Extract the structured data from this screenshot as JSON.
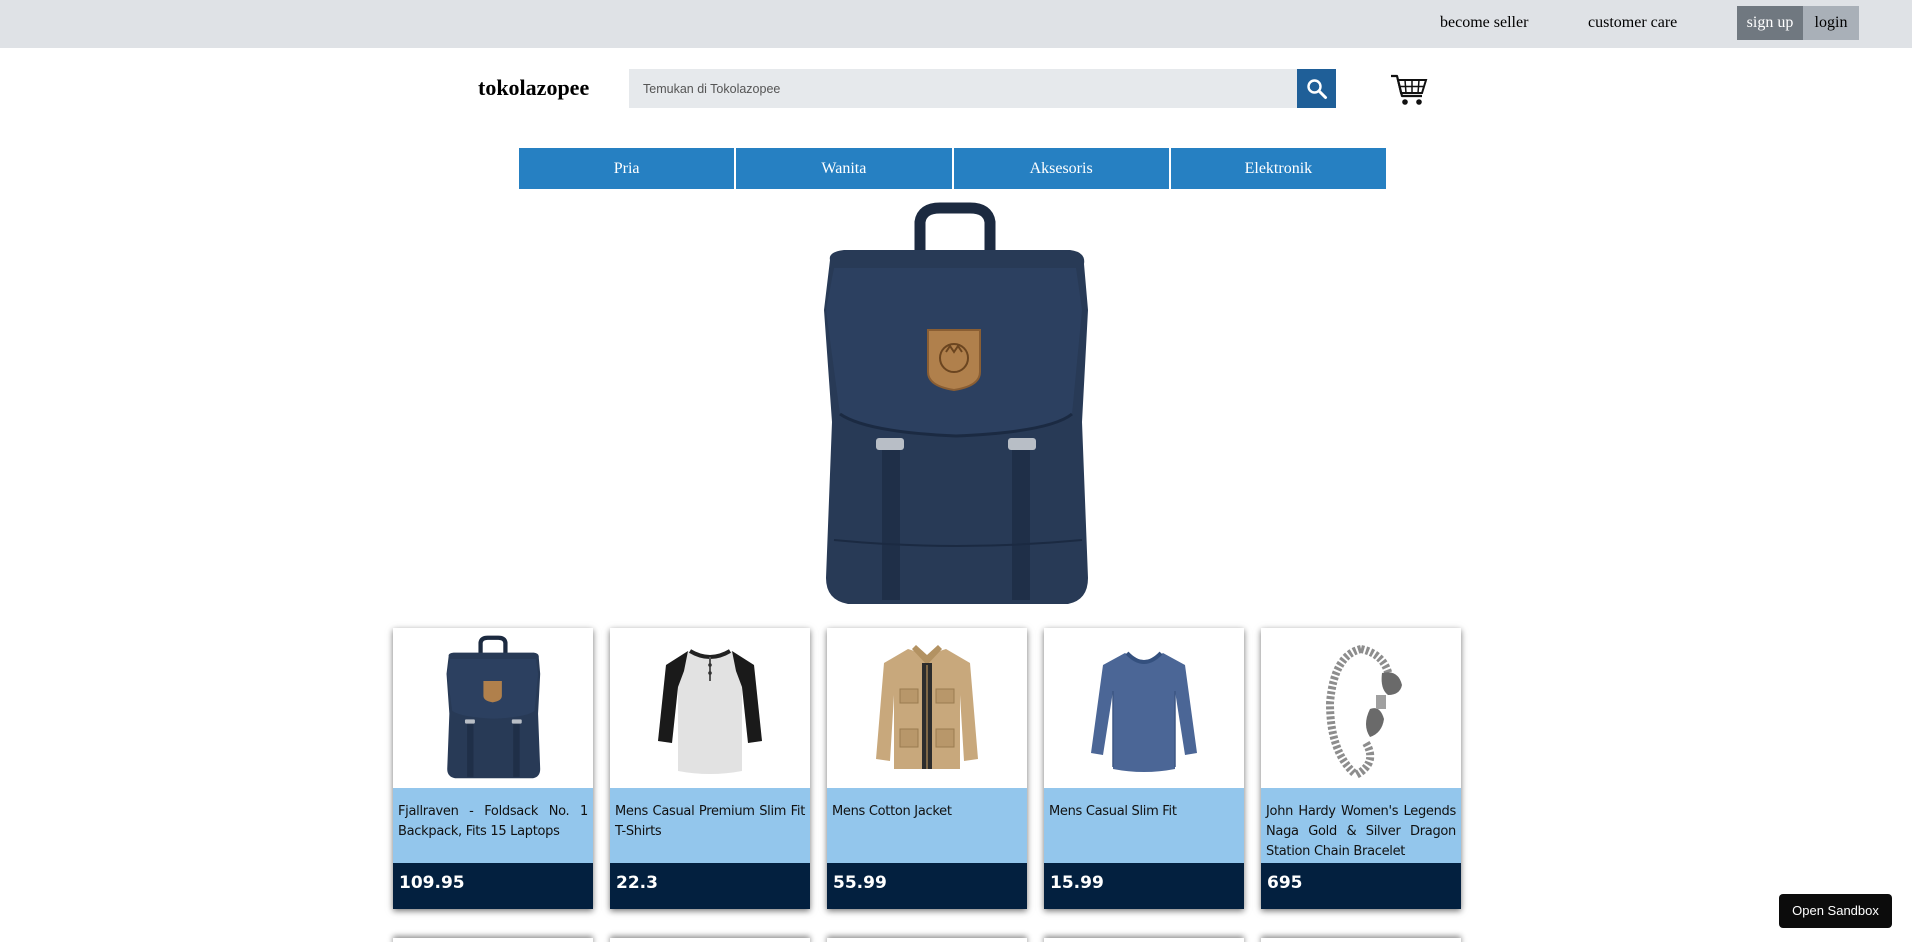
{
  "topbar": {
    "become_seller": "become seller",
    "customer_care": "customer care",
    "sign_up": "sign up",
    "login": "login"
  },
  "header": {
    "brand": "tokolazopee",
    "search_placeholder": "Temukan di Tokolazopee",
    "search_icon": "search-icon",
    "cart_icon": "shopping-cart-icon"
  },
  "nav": {
    "items": [
      "Pria",
      "Wanita",
      "Aksesoris",
      "Elektronik"
    ]
  },
  "hero": {
    "image": "navy-backpack"
  },
  "products": [
    {
      "name": "Fjallraven - Foldsack No. 1 Backpack, Fits 15 Laptops",
      "price": "109.95",
      "image": "navy-backpack"
    },
    {
      "name": "Mens Casual Premium Slim Fit T-Shirts",
      "price": "22.3",
      "image": "raglan-henley-shirt"
    },
    {
      "name": "Mens Cotton Jacket",
      "price": "55.99",
      "image": "beige-jacket"
    },
    {
      "name": "Mens Casual Slim Fit",
      "price": "15.99",
      "image": "blue-long-sleeve-shirt"
    },
    {
      "name": "John Hardy Women's Legends Naga Gold & Silver Dragon Station Chain Bracelet",
      "price": "695",
      "image": "silver-dragon-bracelet"
    }
  ],
  "colors": {
    "topbar": "#dfe2e6",
    "nav": "#2680c2",
    "search_button": "#1f5f98",
    "card_name_bg": "#93c6ec",
    "card_price_bg": "#03203f"
  },
  "sandbox_button": "Open Sandbox"
}
